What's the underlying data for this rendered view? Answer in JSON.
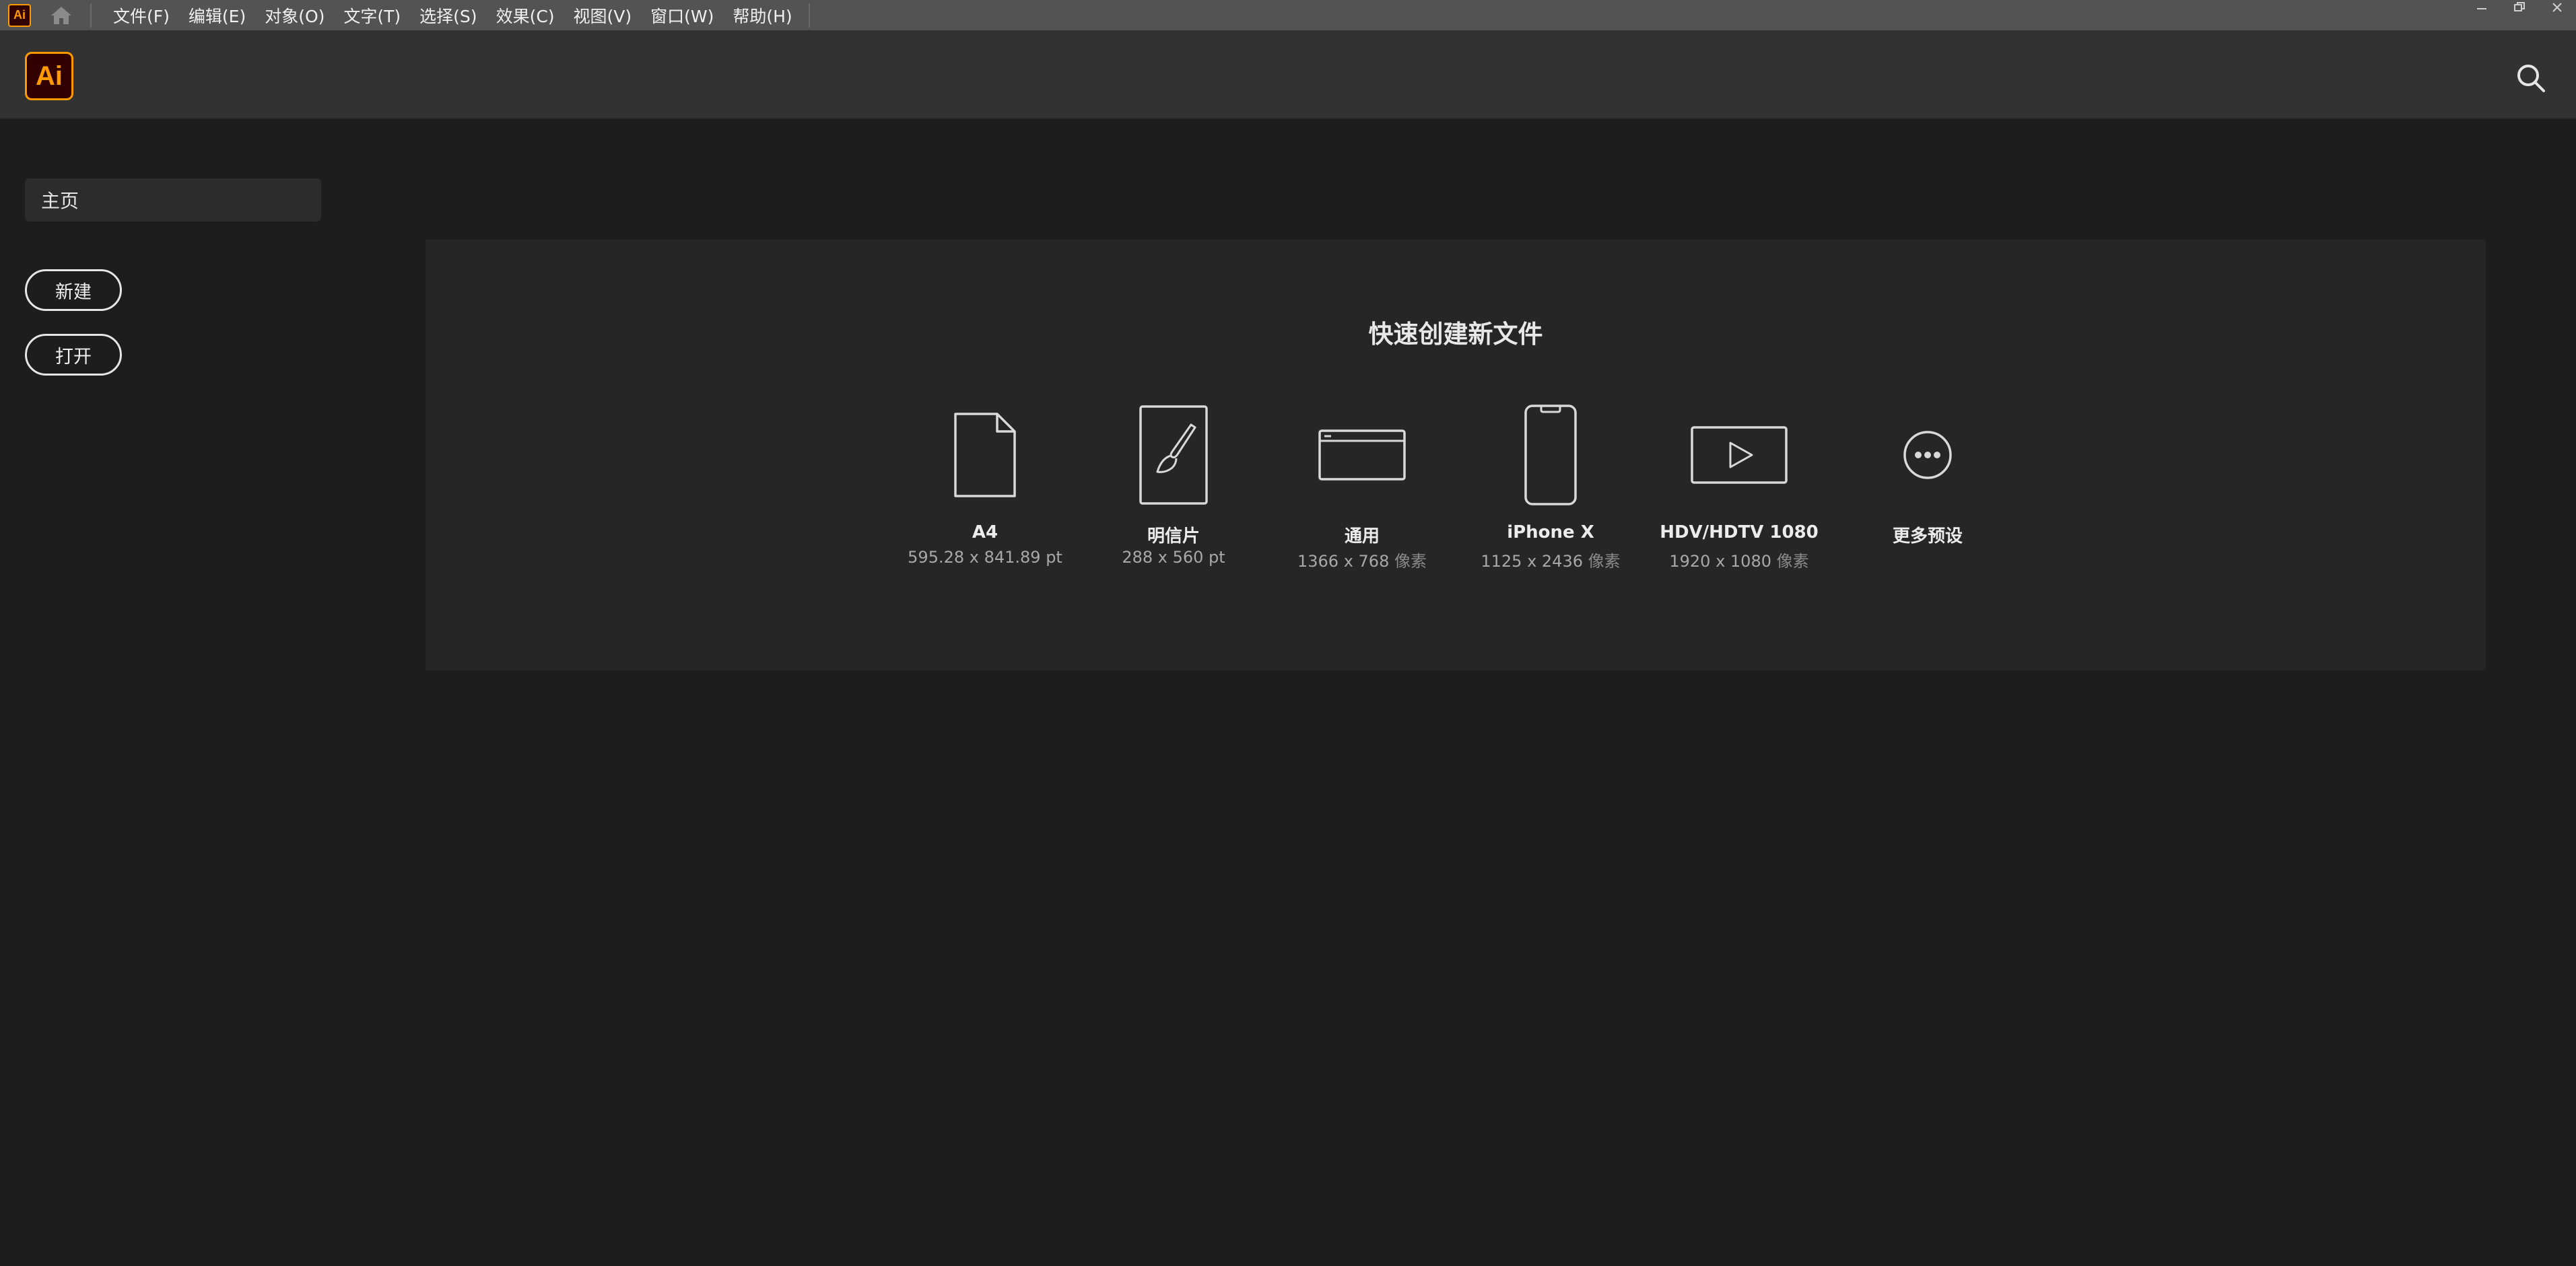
{
  "menubar": {
    "app_icon_text": "Ai",
    "items": [
      "文件(F)",
      "编辑(E)",
      "对象(O)",
      "文字(T)",
      "选择(S)",
      "效果(C)",
      "视图(V)",
      "窗口(W)",
      "帮助(H)"
    ]
  },
  "header": {
    "logo_text": "Ai"
  },
  "sidebar": {
    "home_label": "主页",
    "new_label": "新建",
    "open_label": "打开"
  },
  "quick_create": {
    "title": "快速创建新文件",
    "presets": [
      {
        "name": "A4",
        "size": "595.28 x 841.89 pt",
        "unit": "",
        "icon": "document-icon"
      },
      {
        "name": "明信片",
        "size": "288 x 560 pt",
        "unit": "",
        "icon": "brush-card-icon"
      },
      {
        "name": "通用",
        "size": "1366 x 768",
        "unit": "像素",
        "icon": "browser-window-icon"
      },
      {
        "name": "iPhone X",
        "size": "1125 x 2436",
        "unit": "像素",
        "icon": "phone-icon"
      },
      {
        "name": "HDV/HDTV 1080",
        "size": "1920 x 1080",
        "unit": "像素",
        "icon": "video-play-icon"
      },
      {
        "name": "更多预设",
        "size": "",
        "unit": "",
        "icon": "more-icon"
      }
    ]
  },
  "colors": {
    "menubar_bg": "#535353",
    "header_bg": "#323232",
    "app_bg": "#1d1d1d",
    "panel_bg": "#262626",
    "ai_orange": "#ff9a00",
    "ai_dark": "#330000"
  }
}
